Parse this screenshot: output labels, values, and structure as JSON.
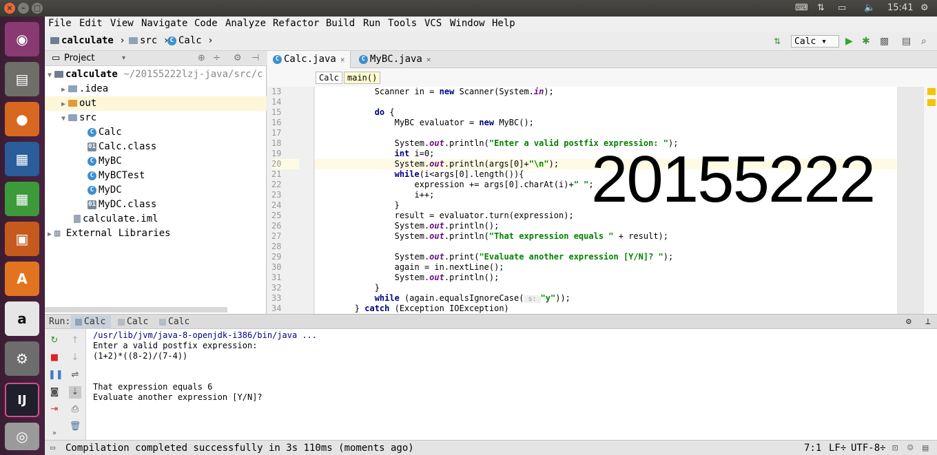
{
  "system": {
    "time": "15:41",
    "window_close": "×",
    "window_min": "–",
    "window_max": "□"
  },
  "menu": [
    "File",
    "Edit",
    "View",
    "Navigate",
    "Code",
    "Analyze",
    "Refactor",
    "Build",
    "Run",
    "Tools",
    "VCS",
    "Window",
    "Help"
  ],
  "breadcrumb": {
    "project": "calculate",
    "folder": "src",
    "file": "Calc"
  },
  "run_config": "Calc",
  "project_panel": {
    "title": "Project",
    "root": {
      "name": "calculate",
      "path": "~/20155222lzj-java/src/c"
    },
    "items": [
      {
        "label": ".idea",
        "type": "folder",
        "indent": 1
      },
      {
        "label": "out",
        "type": "folder-orange",
        "indent": 1
      },
      {
        "label": "src",
        "type": "folder",
        "indent": 1
      },
      {
        "label": "Calc",
        "type": "class",
        "indent": 3
      },
      {
        "label": "Calc.class",
        "type": "file",
        "indent": 3
      },
      {
        "label": "MyBC",
        "type": "class",
        "indent": 3
      },
      {
        "label": "MyBCTest",
        "type": "class",
        "indent": 3
      },
      {
        "label": "MyDC",
        "type": "class",
        "indent": 3
      },
      {
        "label": "MyDC.class",
        "type": "file",
        "indent": 3
      },
      {
        "label": "calculate.iml",
        "type": "file",
        "indent": 2
      },
      {
        "label": "External Libraries",
        "type": "lib",
        "indent": 0
      }
    ]
  },
  "editor": {
    "tabs": [
      {
        "label": "Calc.java",
        "active": true
      },
      {
        "label": "MyBC.java",
        "active": false
      }
    ],
    "crumbs": [
      "Calc",
      "main()"
    ],
    "line_numbers": [
      "13",
      "14",
      "15",
      "16",
      "17",
      "18",
      "19",
      "20",
      "21",
      "22",
      "23",
      "24",
      "25",
      "26",
      "27",
      "28",
      "29",
      "30",
      "31",
      "32",
      "33",
      "34"
    ],
    "current_line": "20",
    "code": {
      "l13_a": "            Scanner in = ",
      "l13_kw": "new",
      "l13_b": " Scanner(System.",
      "l13_f": "in",
      "l13_c": ");",
      "l15_kw": "do",
      "l15_b": " {",
      "l16_a": "                MyBC evaluator = ",
      "l16_kw": "new",
      "l16_b": " MyBC();",
      "l18_a": "                System.",
      "l18_f": "out",
      "l18_b": ".println(",
      "l18_s": "\"Enter a valid postfix expression: \"",
      "l18_c": ");",
      "l19_kw": "int",
      "l19_b": " i=0;",
      "l20_a": "                System.",
      "l20_f": "out",
      "l20_b": ".println(args[0]+",
      "l20_s": "\"\\n\"",
      "l20_c": ");",
      "l21_kw": "while",
      "l21_b": "(i<args[0].length()){",
      "l22_a": "                    expression += args[0].charAt(i)+",
      "l22_s": "\" \"",
      "l22_c": ";",
      "l23": "                    i++;",
      "l24": "                }",
      "l25": "                result = evaluator.turn(expression);",
      "l26_a": "                System.",
      "l26_f": "out",
      "l26_b": ".println();",
      "l27_a": "                System.",
      "l27_f": "out",
      "l27_b": ".println(",
      "l27_s": "\"That expression equals \"",
      "l27_c": " + result);",
      "l29_a": "                System.",
      "l29_f": "out",
      "l29_b": ".print(",
      "l29_s": "\"Evaluate another expression [Y/N]? \"",
      "l29_c": ");",
      "l30": "                again = in.nextLine();",
      "l31_a": "                System.",
      "l31_f": "out",
      "l31_b": ".println();",
      "l32": "            }",
      "l33_kw": "while",
      "l33_b": " (again.equalsIgnoreCase(",
      "l33_hint": " s: ",
      "l33_s": "\"y\"",
      "l33_c": "));",
      "l34_a": "        } ",
      "l34_kw": "catch",
      "l34_b": " (Exception IOException)"
    }
  },
  "watermark": "20155222",
  "run_panel": {
    "label": "Run:",
    "tabs": [
      "Calc",
      "Calc",
      "Calc"
    ],
    "console": [
      "/usr/lib/jvm/java-8-openjdk-i386/bin/java ...",
      "Enter a valid postfix expression:",
      "(1+2)*((8-2)/(7-4))",
      "",
      "",
      "That expression equals 6",
      "Evaluate another expression [Y/N]?"
    ]
  },
  "status": {
    "message": "Compilation completed successfully in 3s 110ms (moments ago)",
    "position": "7:1",
    "line_sep": "LF÷",
    "encoding": "UTF-8÷"
  },
  "launcher_labels": [
    "IJ",
    "a"
  ]
}
